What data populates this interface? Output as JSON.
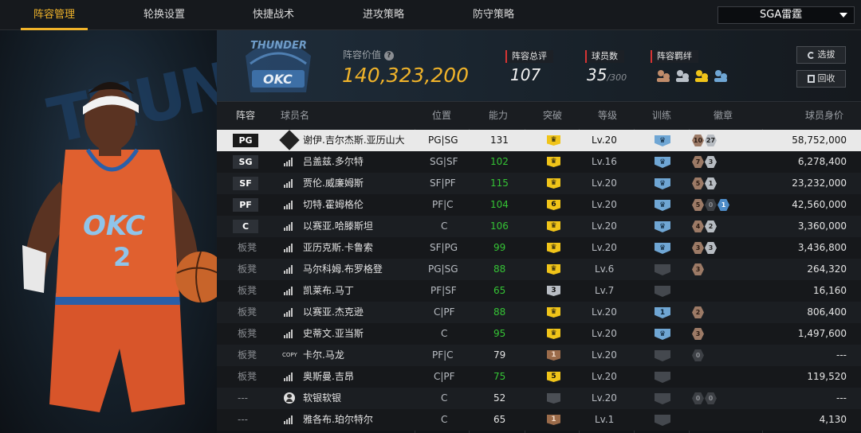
{
  "nav": {
    "tabs": [
      "阵容管理",
      "轮换设置",
      "快捷战术",
      "进攻策略",
      "防守策略"
    ],
    "active_tab": "阵容管理",
    "team_select": "SGA雷霆"
  },
  "team": {
    "value_label": "阵容价值",
    "value": "140,323,200",
    "rating_label": "阵容总评",
    "rating": "107",
    "players_label": "球员数",
    "players_count": "35",
    "players_max": "/300",
    "bonds_label": "阵容羁绊",
    "logo_letters": "THUNDER",
    "logo_text": "OKC",
    "select_button": "选拔",
    "recycle_button": "回收"
  },
  "jersey": {
    "text": "OKC",
    "number": "2"
  },
  "table": {
    "headers": [
      "阵容",
      "球员名",
      "位置",
      "能力",
      "突破",
      "等级",
      "训练",
      "徽章",
      "球员身价"
    ],
    "rows": [
      {
        "slot": "PG",
        "name": "谢伊.吉尔杰斯.亚历山大",
        "pos": "PG|SG",
        "ability": "131",
        "break": "crown",
        "level": "Lv.20",
        "train": "crown",
        "badges": [
          "10",
          "27"
        ],
        "value": "58,752,000"
      },
      {
        "slot": "SG",
        "name": "吕盖兹.多尔特",
        "pos": "SG|SF",
        "ability": "102",
        "break": "crown",
        "level": "Lv.16",
        "train": "crown",
        "badges": [
          "7",
          "3"
        ],
        "value": "6,278,400"
      },
      {
        "slot": "SF",
        "name": "贾伦.威廉姆斯",
        "pos": "SF|PF",
        "ability": "115",
        "break": "crown",
        "level": "Lv.20",
        "train": "crown",
        "badges": [
          "5",
          "1"
        ],
        "value": "23,232,000"
      },
      {
        "slot": "PF",
        "name": "切特.霍姆格伦",
        "pos": "PF|C",
        "ability": "104",
        "break": "6",
        "level": "Lv.20",
        "train": "crown",
        "badges": [
          "5",
          "0",
          "1"
        ],
        "value": "42,560,000"
      },
      {
        "slot": "C",
        "name": "以赛亚.哈滕斯坦",
        "pos": "C",
        "ability": "106",
        "break": "crown",
        "level": "Lv.20",
        "train": "crown",
        "badges": [
          "4",
          "2"
        ],
        "value": "3,360,000"
      },
      {
        "slot": "板凳",
        "name": "亚历克斯.卡鲁索",
        "pos": "SF|PG",
        "ability": "99",
        "break": "crown",
        "level": "Lv.20",
        "train": "crown",
        "badges": [
          "3",
          "3"
        ],
        "value": "3,436,800"
      },
      {
        "slot": "板凳",
        "name": "马尔科姆.布罗格登",
        "pos": "PG|SG",
        "ability": "88",
        "break": "crown",
        "level": "Lv.6",
        "train": "",
        "badges": [
          "3"
        ],
        "value": "264,320"
      },
      {
        "slot": "板凳",
        "name": "凯莱布.马丁",
        "pos": "PF|SF",
        "ability": "65",
        "break": "3",
        "level": "Lv.7",
        "train": "",
        "badges": [],
        "value": "16,160"
      },
      {
        "slot": "板凳",
        "name": "以赛亚.杰克逊",
        "pos": "C|PF",
        "ability": "88",
        "break": "crown",
        "level": "Lv.20",
        "train": "1",
        "badges": [
          "2"
        ],
        "value": "806,400"
      },
      {
        "slot": "板凳",
        "name": "史蒂文.亚当斯",
        "pos": "C",
        "ability": "95",
        "break": "crown",
        "level": "Lv.20",
        "train": "crown",
        "badges": [
          "3"
        ],
        "value": "1,497,600"
      },
      {
        "slot": "板凳",
        "name": "卡尔.马龙",
        "pos": "PF|C",
        "ability": "79",
        "break": "1",
        "level": "Lv.20",
        "train": "",
        "badges": [
          "0"
        ],
        "value": "---"
      },
      {
        "slot": "板凳",
        "name": "奥斯曼.吉昂",
        "pos": "C|PF",
        "ability": "75",
        "break": "5",
        "level": "Lv.20",
        "train": "",
        "badges": [],
        "value": "119,520"
      },
      {
        "slot": "---",
        "name": "软银软银",
        "pos": "C",
        "ability": "52",
        "break": "",
        "level": "Lv.20",
        "train": "",
        "badges": [
          "0",
          "0"
        ],
        "value": "---"
      },
      {
        "slot": "---",
        "name": "雅各布.珀尔特尔",
        "pos": "C",
        "ability": "65",
        "break": "1",
        "level": "Lv.1",
        "train": "",
        "badges": [],
        "value": "4,130"
      }
    ]
  },
  "copy_label": "COPY",
  "colors": {
    "accent": "#f0b32a",
    "green": "#35c435",
    "value_gold": "#f0b32a"
  }
}
